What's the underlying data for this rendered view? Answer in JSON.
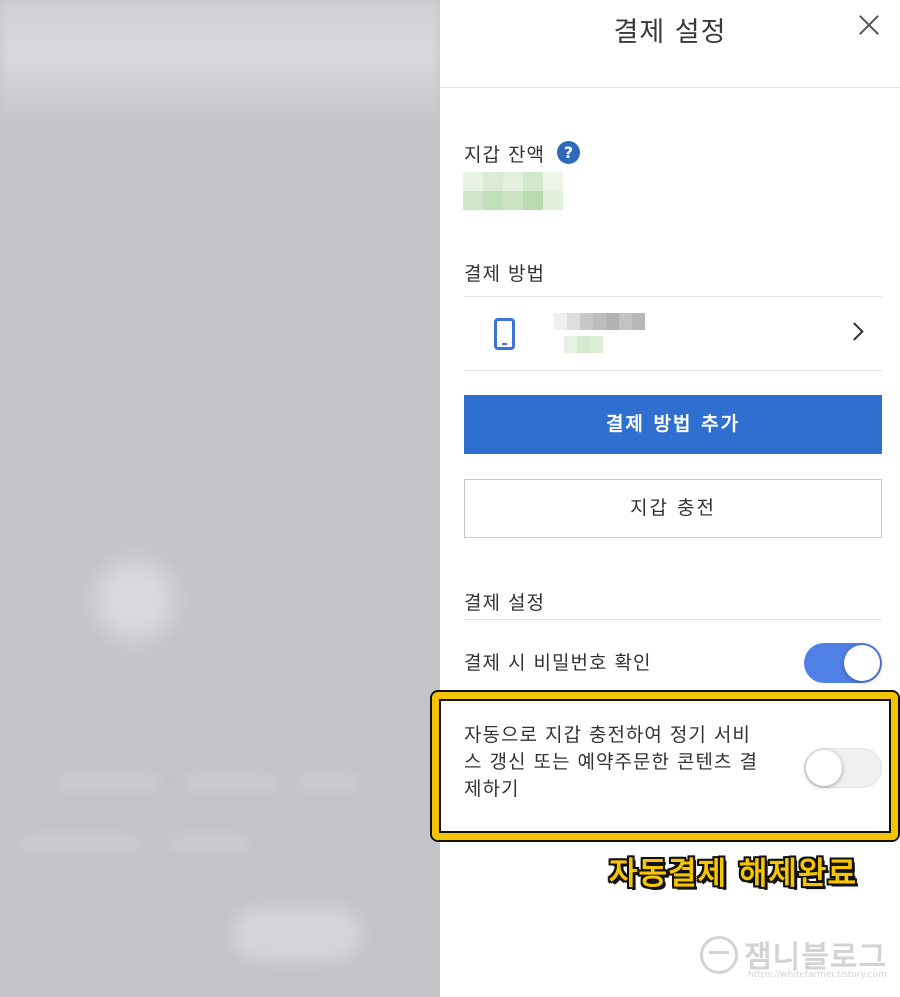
{
  "panel": {
    "title": "결제 설정",
    "close_label": "×"
  },
  "wallet": {
    "balance_label": "지갑 잔액",
    "help_glyph": "?"
  },
  "payment_method": {
    "section_label": "결제 방법",
    "icon": "phone-icon",
    "add_button_label": "결제 방법 추가",
    "charge_button_label": "지갑 충전"
  },
  "settings": {
    "section_label": "결제 설정",
    "password_confirm_label": "결제 시 비밀번호 확인",
    "password_confirm_enabled": true,
    "auto_charge_label": "자동으로 지갑 충전하여 정기 서비스 갱신 또는 예약주문한 콘텐츠 결제하기",
    "auto_charge_enabled": false
  },
  "annotation": {
    "text": "자동결제 해제완료"
  },
  "watermark": {
    "text": "잼니블로그",
    "url": "https://whitefarmer.tistory.com"
  },
  "colors": {
    "primary": "#2f6fd0",
    "toggle_on": "#4f80e6",
    "help_icon": "#2f6ab9",
    "highlight": "#f5c400"
  }
}
